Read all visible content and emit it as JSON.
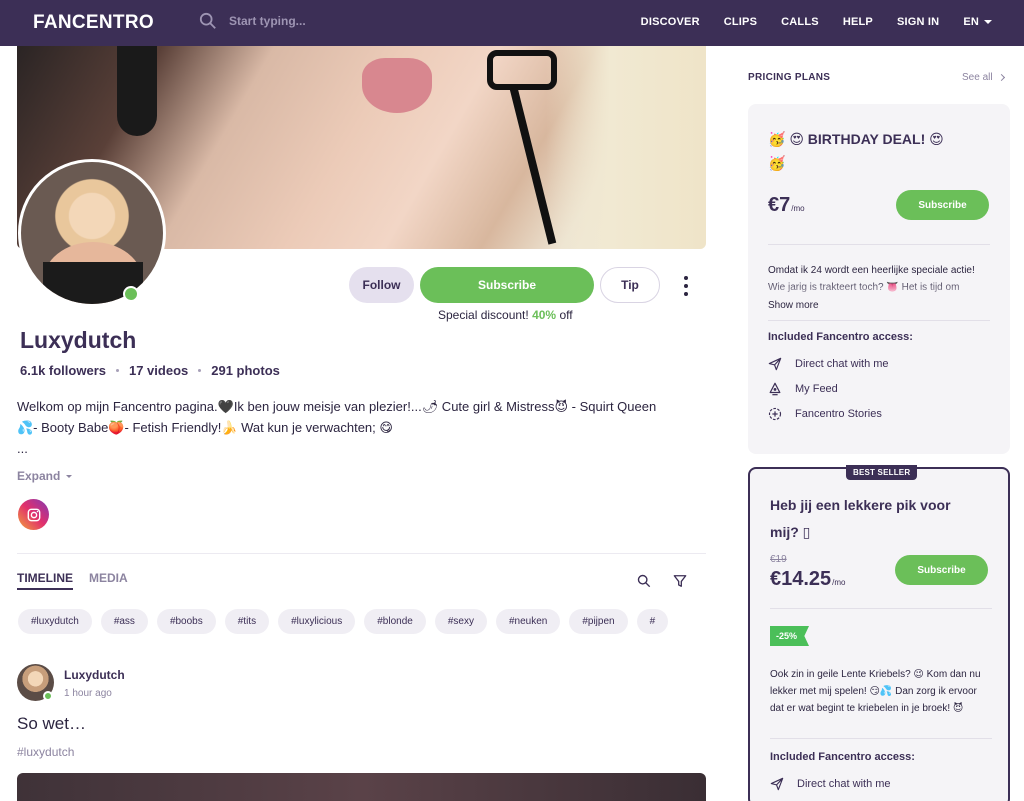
{
  "nav": {
    "logo": "FANCENTRO",
    "search_placeholder": "Start typing...",
    "links": [
      "DISCOVER",
      "CLIPS",
      "CALLS",
      "HELP",
      "SIGN IN"
    ],
    "language": "EN"
  },
  "profile": {
    "name": "Luxydutch",
    "followers": "6.1k followers",
    "videos": "17 videos",
    "photos": "291 photos",
    "bio_line1": "Welkom op mijn Fancentro pagina.🖤Ik ben jouw meisje van plezier!...🌶 Cute girl & Mistress😈 - Squirt Queen",
    "bio_line2": "💦- Booty Babe🍑- Fetish Friendly!🍌 Wat kun je verwachten; 😋",
    "bio_ellipsis": "...",
    "expand_label": "Expand"
  },
  "actions": {
    "follow": "Follow",
    "subscribe": "Subscribe",
    "tip": "Tip",
    "discount_prefix": "Special discount!",
    "discount_value": "40%",
    "discount_suffix": "off"
  },
  "tabs": {
    "timeline": "TIMELINE",
    "media": "MEDIA"
  },
  "hashtags": [
    "#luxydutch",
    "#ass",
    "#boobs",
    "#tits",
    "#luxylicious",
    "#blonde",
    "#sexy",
    "#neuken",
    "#pijpen",
    "#"
  ],
  "post": {
    "author": "Luxydutch",
    "time": "1 hour ago",
    "text": "So wet…",
    "tag": "#luxydutch"
  },
  "pricing": {
    "title": "PRICING PLANS",
    "see_all": "See all",
    "plan1": {
      "title_line1": "🥳 😍 BIRTHDAY DEAL! 😍",
      "title_line2": "🥳",
      "price": "€7",
      "period": "/mo",
      "subscribe": "Subscribe",
      "desc": "Omdat ik 24 wordt een heerlijke speciale actie! Wie jarig is trakteert toch? 👅 Het is tijd om",
      "show_more": "Show more",
      "included_title": "Included Fancentro access:",
      "features": [
        "Direct chat with me",
        "My Feed",
        "Fancentro Stories"
      ]
    },
    "plan2": {
      "badge": "BEST SELLER",
      "title_line1": "Heb jij een lekkere pik voor",
      "title_line2": "mij? ▯",
      "old_price": "€19",
      "price": "€14.25",
      "period": "/mo",
      "subscribe": "Subscribe",
      "discount": "-25%",
      "desc": "Ook zin in geile Lente Kriebels? 😉 Kom dan nu lekker met mij spelen! 😏💦 Dan zorg ik ervoor dat er wat begint te kriebelen in je broek! 😈",
      "included_title": "Included Fancentro access:",
      "features": [
        "Direct chat with me"
      ]
    }
  },
  "colors": {
    "nav_bg": "#3c2f56",
    "accent_green": "#6bbf59",
    "text_dark": "#3c2f56",
    "muted": "#8c84a0"
  }
}
